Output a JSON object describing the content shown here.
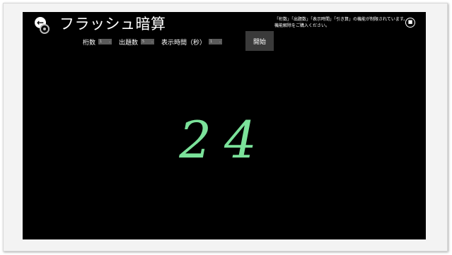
{
  "app": {
    "title": "フラッシュ暗算",
    "notice": [
      "「桁数」「出題数」「表示時間」「引き算」の機能が制限されています。",
      "機能解除をご購入ください。"
    ]
  },
  "controls": {
    "digits_label": "桁数",
    "digits_value": "1",
    "questions_label": "出題数",
    "questions_value": "5",
    "time_label": "表示時間（秒）",
    "time_value": "1",
    "start_label": "開始"
  },
  "display": {
    "number": "24"
  },
  "colors": {
    "background": "#000000",
    "number": "#7be29a",
    "select": "#5a5a5a"
  },
  "icons": {
    "back": "back-arrow-icon",
    "disc": "disc-icon",
    "pin": "pin-icon"
  }
}
